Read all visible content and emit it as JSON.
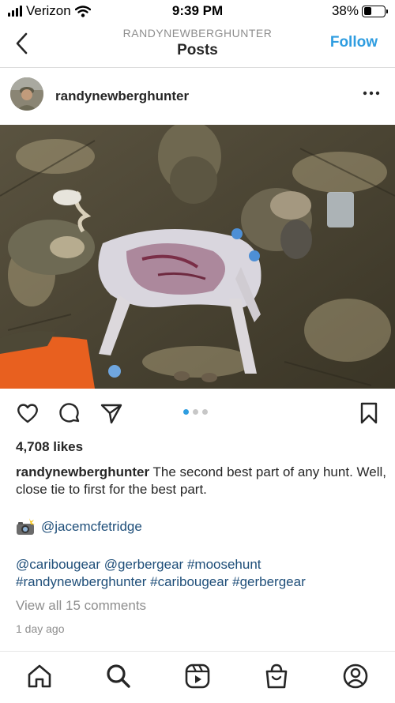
{
  "status_bar": {
    "carrier": "Verizon",
    "time": "9:39 PM",
    "battery": "38%",
    "battery_level": 0.38
  },
  "nav": {
    "username": "RANDYNEWBERGHUNTER",
    "title": "Posts",
    "follow_label": "Follow",
    "accent_color": "#2f9de0"
  },
  "post": {
    "username": "randynewberghunter",
    "photo_description_icon": "photo",
    "carousel_dots": 3,
    "carousel_active": 1,
    "likes": "4,708 likes",
    "caption_user": "randynewberghunter",
    "caption_text": "The second best part of any hunt. Well, close tie to first for the best part.",
    "credit_icon": "camera-flash-emoji",
    "credit_handle": "@jacemcfetridge",
    "tags": [
      "@caribougear",
      "@gerbergear",
      "#moosehunt",
      "#randynewberghunter",
      "#caribougear",
      "#gerbergear"
    ],
    "view_comments": "View all 15 comments",
    "time_ago": "1 day ago"
  },
  "tabbar": {
    "items": [
      "home-icon",
      "search-icon",
      "reels-icon",
      "shop-icon",
      "profile-icon"
    ]
  }
}
